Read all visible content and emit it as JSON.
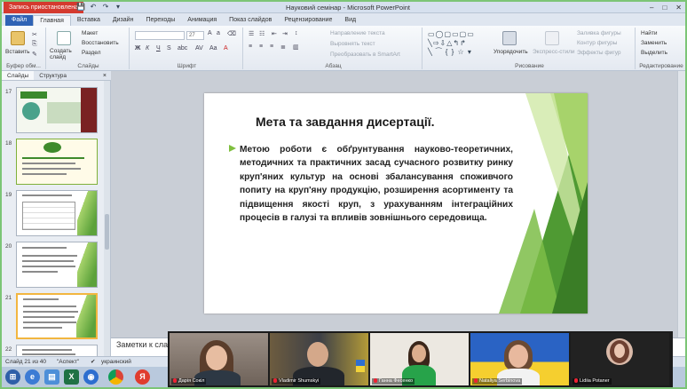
{
  "window": {
    "recording_badge": "Запись приостановлена",
    "title": "Науковий семінар - Microsoft PowerPoint",
    "controls": [
      "–",
      "□",
      "✕"
    ]
  },
  "qat": [
    "💾",
    "↶",
    "↷",
    "▾"
  ],
  "tabs": [
    "Файл",
    "Главная",
    "Вставка",
    "Дизайн",
    "Переходы",
    "Анимация",
    "Показ слайдов",
    "Рецензирование",
    "Вид"
  ],
  "ribbon": {
    "clipboard": {
      "paste": "Вставить",
      "label": "Буфер обм..."
    },
    "slides": {
      "new_slide": "Создать слайд",
      "layout": "Макет",
      "reset": "Восстановить",
      "section": "Раздел",
      "label": "Слайды"
    },
    "font": {
      "font_name": "",
      "font_size": "27",
      "label": "Шрифт"
    },
    "paragraph": {
      "text_direction": "Направление текста",
      "align_text": "Выровнять текст",
      "smartart": "Преобразовать в SmartArt",
      "label": "Абзац"
    },
    "drawing": {
      "arrange": "Упорядочить",
      "quick_styles": "Экспресс-стили",
      "fill": "Заливка фигуры",
      "outline": "Контур фигуры",
      "effects": "Эффекты фигур",
      "label": "Рисование"
    },
    "editing": {
      "find": "Найти",
      "replace": "Заменить",
      "select": "Выделить",
      "label": "Редактирование"
    }
  },
  "pane": {
    "tabs": [
      "Слайды",
      "Структура"
    ],
    "close": "×",
    "thumbnails": [
      {
        "number": "17"
      },
      {
        "number": "18"
      },
      {
        "number": "19"
      },
      {
        "number": "20"
      },
      {
        "number": "21"
      },
      {
        "number": "22"
      }
    ]
  },
  "slide": {
    "title": "Мета та завдання дисертації.",
    "body": "Метою роботи є обґрунтування науково-теоретичних, методичних та практичних засад сучасного розвитку ринку круп'яних культур на основі збалансування споживчого попиту на круп'яну продукцію, розширення асортименту та підвищення якості круп, з урахуванням інтеграційних процесів в галузі та впливів зовнішнього середовища."
  },
  "notes": {
    "label": "Заметки к сла"
  },
  "status": {
    "slide_info": "Слайд 21 из 40",
    "theme": "\"Аспект\"",
    "language": "украинский"
  },
  "video": {
    "participants": [
      {
        "name": "Дарія Сокіл"
      },
      {
        "name": "Vladimir Shumskyi"
      },
      {
        "name": "Ганна Фесенко"
      },
      {
        "name": "Nataliya Serbinova"
      },
      {
        "name": "Lidiia Potaner"
      }
    ]
  },
  "colors": {
    "slide_green_dark": "#3f8a2c",
    "slide_green_light": "#a7d36b",
    "bullet_green": "#7fbf3f",
    "file_tab": "#2f63b5",
    "recording_red": "#d43a2f"
  }
}
